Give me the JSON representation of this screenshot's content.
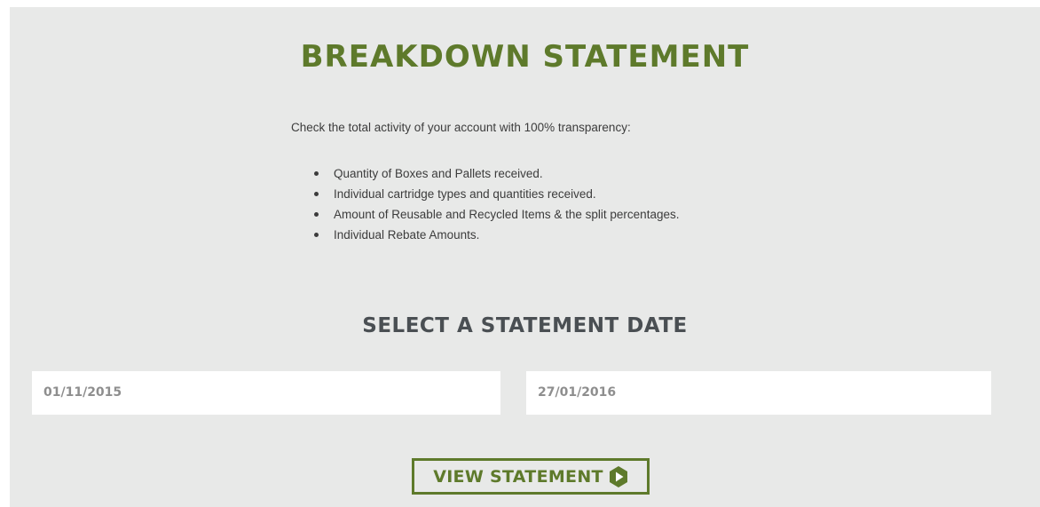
{
  "header": {
    "title": "BREAKDOWN STATEMENT"
  },
  "intro": {
    "text": "Check the total activity of your account with 100% transparency:"
  },
  "features": [
    "Quantity of Boxes and Pallets received.",
    "Individual cartridge types and quantities received.",
    "Amount of Reusable and Recycled Items & the split percentages.",
    "Individual Rebate Amounts."
  ],
  "date_selector": {
    "title": "SELECT A STATEMENT DATE",
    "start_date": "01/11/2015",
    "end_date": "27/01/2016"
  },
  "actions": {
    "view_label": "VIEW STATEMENT",
    "view_icon": "play-hexagon-icon"
  },
  "colors": {
    "accent": "#5e7a2b",
    "panel_bg": "#e8e9e8",
    "subtitle": "#4a4f53"
  }
}
